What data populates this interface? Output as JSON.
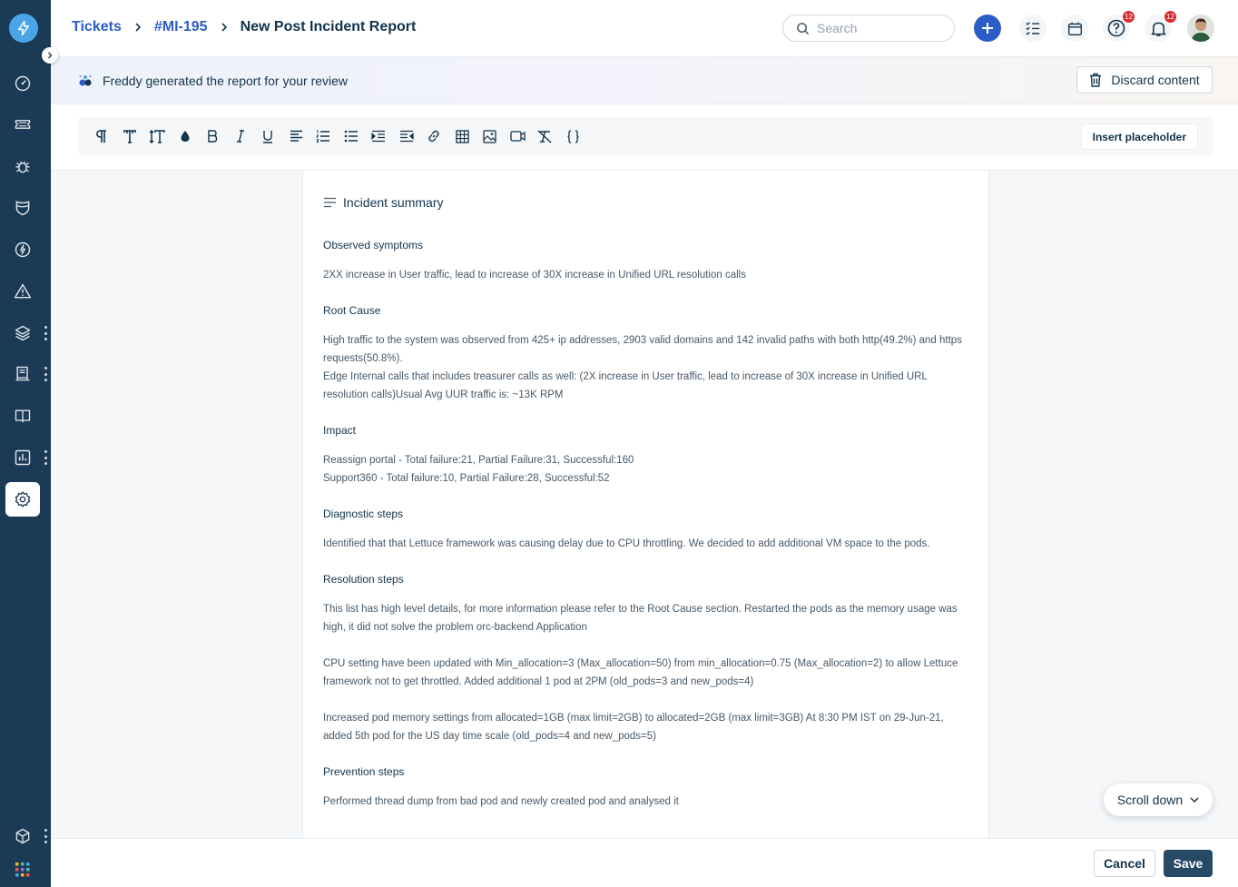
{
  "colors": {
    "sidebar": "#1b3a55",
    "accent": "#2c5cc5",
    "save": "#264966",
    "badge": "#d72d30"
  },
  "sidebar": {
    "items": [
      {
        "icon": "dashboard-icon"
      },
      {
        "icon": "ticket-icon"
      },
      {
        "icon": "bug-icon"
      },
      {
        "icon": "shield-icon"
      },
      {
        "icon": "bolt-icon"
      },
      {
        "icon": "alert-icon"
      },
      {
        "icon": "layers-icon"
      },
      {
        "icon": "inventory-icon"
      },
      {
        "icon": "book-icon"
      },
      {
        "icon": "analytics-icon"
      },
      {
        "icon": "settings-icon",
        "active": true
      },
      {
        "icon": "cube-icon"
      },
      {
        "icon": "apps-grid-icon"
      }
    ]
  },
  "header": {
    "breadcrumbs": [
      "Tickets",
      "#MI-195",
      "New Post Incident Report"
    ],
    "search_placeholder": "Search",
    "help_badge": "12",
    "notifications_badge": "12"
  },
  "banner": {
    "text": "Freddy generated the report for your review",
    "discard_label": "Discard content"
  },
  "toolbar": {
    "insert_placeholder_label": "Insert placeholder",
    "buttons": [
      "paragraph-icon",
      "font-icon",
      "font-size-icon",
      "text-color-icon",
      "bold-icon",
      "italic-icon",
      "underline-icon",
      "align-icon",
      "ordered-list-icon",
      "bullet-list-icon",
      "indent-icon",
      "outdent-icon",
      "link-icon",
      "table-icon",
      "image-icon",
      "video-icon",
      "clear-format-icon",
      "code-icon"
    ]
  },
  "document": {
    "title": "Incident summary",
    "sections": [
      {
        "heading": "Observed symptoms",
        "paragraphs": [
          "2XX increase in User traffic, lead to increase of 30X increase in Unified URL resolution calls"
        ]
      },
      {
        "heading": "Root Cause",
        "paragraphs": [
          "High traffic to the system was observed from 425+ ip addresses, 2903 valid domains and 142 invalid paths with both http(49.2%) and https requests(50.8%).\nEdge Internal calls that includes treasurer calls as well: (2X increase in User traffic, lead to increase of 30X increase in Unified URL resolution calls)Usual Avg UUR traffic is: ~13K RPM"
        ]
      },
      {
        "heading": "Impact",
        "paragraphs": [
          "Reassign portal - Total failure:21, Partial Failure:31, Successful:160\nSupport360 - Total failure:10, Partial Failure:28, Successful:52"
        ]
      },
      {
        "heading": "Diagnostic steps",
        "paragraphs": [
          "Identified that that Lettuce framework was causing delay due to CPU throttling. We decided to add additional VM space to the pods."
        ]
      },
      {
        "heading": "Resolution steps",
        "paragraphs": [
          "This list has high level details, for more information please refer to the Root Cause section. Restarted the pods as the memory usage was high, it did not solve the problem orc-backend Application",
          "CPU setting have been updated with Min_allocation=3 (Max_allocation=50) from min_allocation=0.75 (Max_allocation=2) to allow Lettuce framework not to get throttled. Added additional 1 pod at 2PM (old_pods=3 and new_pods=4)",
          "Increased pod memory settings from allocated=1GB (max limit=2GB) to allocated=2GB (max limit=3GB) At 8:30 PM IST on 29-Jun-21, added 5th pod for the US day time scale (old_pods=4 and new_pods=5)"
        ]
      },
      {
        "heading": "Prevention steps",
        "paragraphs": [
          "Performed thread dump from bad pod and newly created pod and analysed it"
        ]
      }
    ]
  },
  "scroll_down_label": "Scroll down",
  "footer": {
    "cancel_label": "Cancel",
    "save_label": "Save"
  }
}
